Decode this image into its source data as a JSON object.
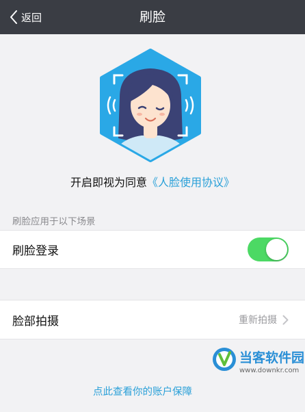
{
  "nav": {
    "back_label": "返回",
    "title": "刷脸"
  },
  "face": {
    "illustration_icon": "face-scan-icon",
    "hex_color": "#2aa8e6"
  },
  "consent": {
    "prefix": "开启即视为同意",
    "link": "《人脸使用协议》"
  },
  "section": {
    "header": "刷脸应用于以下场景"
  },
  "login_row": {
    "label": "刷脸登录",
    "toggle_on": true,
    "toggle_color": "#4cd964"
  },
  "shoot_row": {
    "label": "脸部拍摄",
    "action": "重新拍摄"
  },
  "bottom": {
    "link": "点此查看你的账户保障"
  },
  "watermark": {
    "name": "当客软件园",
    "url": "www.downkr.com"
  }
}
